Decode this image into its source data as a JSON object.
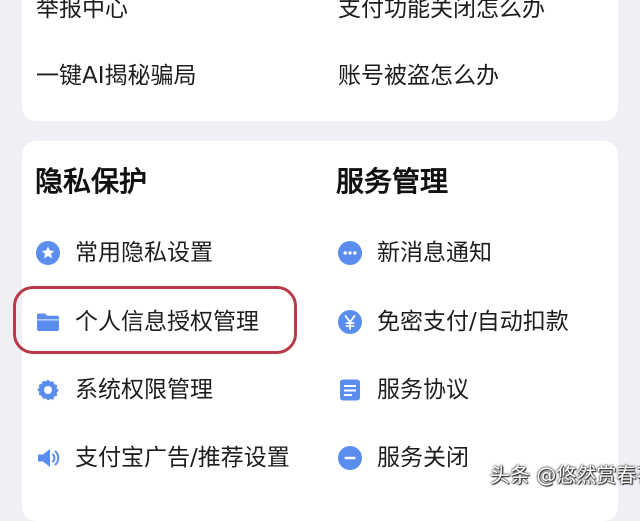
{
  "help_section": {
    "links": [
      {
        "label": "举报中心"
      },
      {
        "label": "支付功能关闭怎么办"
      },
      {
        "label": "一键AI揭秘骗局"
      },
      {
        "label": "账号被盗怎么办"
      }
    ]
  },
  "privacy": {
    "title": "隐私保护",
    "items": [
      {
        "label": "常用隐私设置",
        "icon": "star-icon"
      },
      {
        "label": "个人信息授权管理",
        "icon": "folder-icon"
      },
      {
        "label": "系统权限管理",
        "icon": "gear-icon"
      },
      {
        "label": "支付宝广告/推荐设置",
        "icon": "speaker-icon"
      }
    ]
  },
  "service": {
    "title": "服务管理",
    "items": [
      {
        "label": "新消息通知",
        "icon": "chat-bubble-icon"
      },
      {
        "label": "免密支付/自动扣款",
        "icon": "yen-icon"
      },
      {
        "label": "服务协议",
        "icon": "document-icon"
      },
      {
        "label": "服务关闭",
        "icon": "minus-circle-icon"
      }
    ]
  },
  "colors": {
    "icon_blue": "#5b8def",
    "highlight_red": "#b83a47",
    "background": "#eef0f5"
  },
  "watermark": "头条 @悠然赏春花"
}
